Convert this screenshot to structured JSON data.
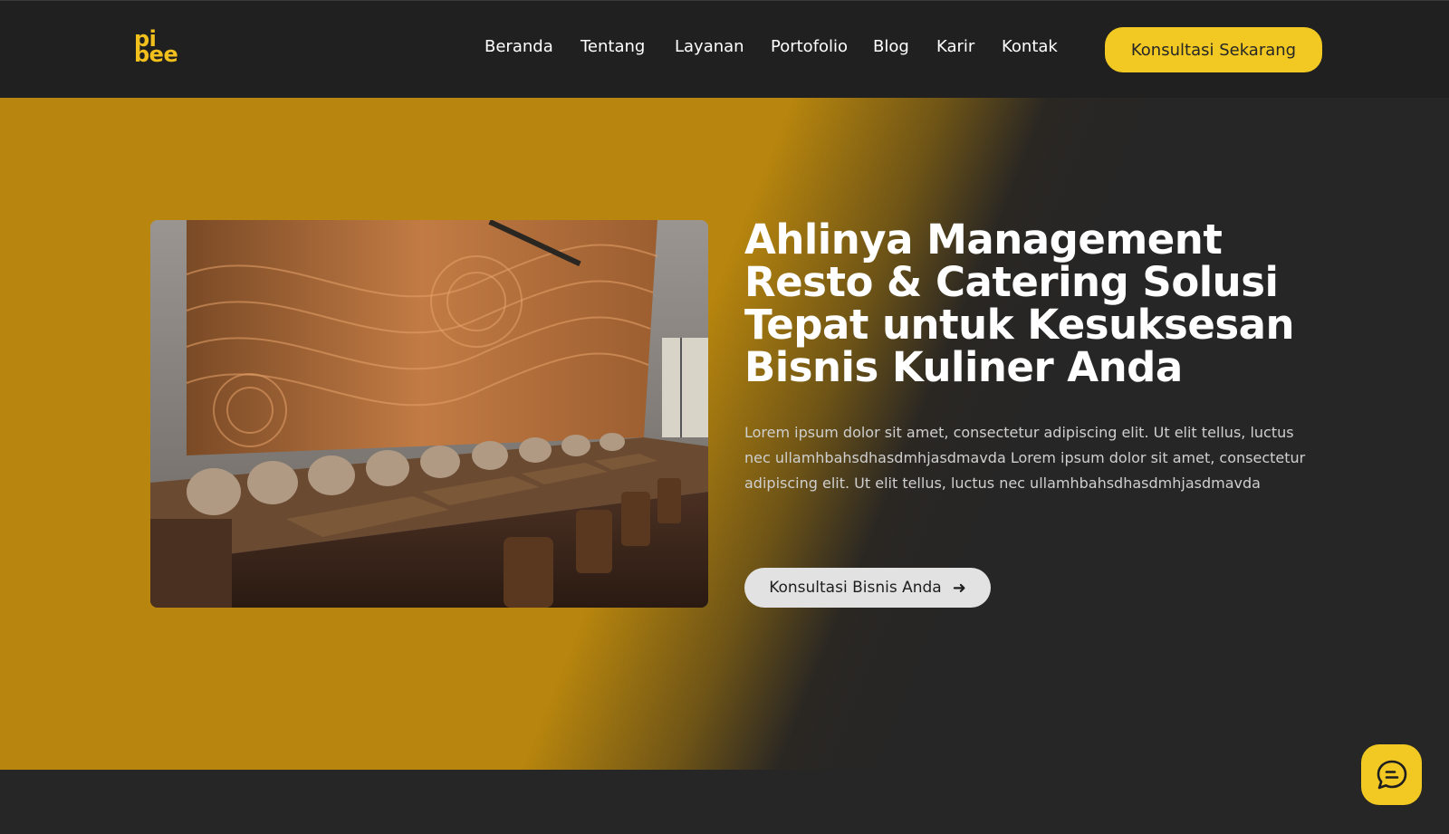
{
  "header": {
    "logo_line1": "pi",
    "logo_line2": "bee",
    "nav": [
      "Beranda",
      "Tentang",
      "Layanan",
      "Portofolio",
      "Blog",
      "Karir",
      "Kontak"
    ],
    "cta_label": "Konsultasi Sekarang"
  },
  "hero": {
    "title": "Ahlinya Management Resto & Catering Solusi Tepat untuk Kesuksesan Bisnis Kuliner Anda",
    "description": "Lorem ipsum dolor sit amet, consectetur adipiscing elit. Ut elit tellus, luctus nec ullamhbahsdhasdmhjasdmavda Lorem ipsum dolor sit amet, consectetur adipiscing elit. Ut elit tellus, luctus nec ullamhbahsdhasdmhjasdmavda",
    "button_label": "Konsultasi Bisnis Anda",
    "button_icon": "arrow-right-icon",
    "image": "restaurant-interior-image"
  },
  "chat": {
    "icon": "chat-bubble-icon"
  },
  "colors": {
    "accent": "#f2c922",
    "hero_gold": "#b8860e",
    "background": "#262626",
    "header_bg": "#202020"
  }
}
